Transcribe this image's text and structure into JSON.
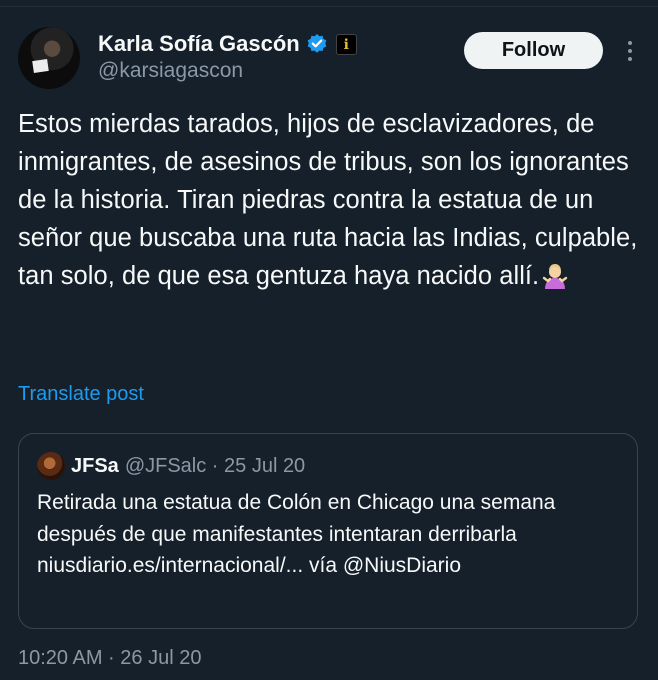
{
  "post": {
    "author": {
      "display_name": "Karla Sofía Gascón",
      "handle": "@karsiagascon",
      "verified_icon": "verified-badge-icon",
      "affiliation_icon": "affiliate-badge-icon",
      "affiliation_glyph": "ℹ"
    },
    "follow_label": "Follow",
    "text": "Estos mierdas tarados, hijos de esclavizadores, de inmigrantes, de asesinos de tribus, son los ignorantes de la historia. Tiran piedras contra la estatua de un señor que buscaba una ruta hacia las Indias, culpable, tan solo, de que esa gentuza haya nacido allí.",
    "emoji": "person-shrugging-emoji",
    "translate_label": "Translate post",
    "timestamp": "10:20 AM · 26 Jul 20"
  },
  "quoted_post": {
    "display_name": "JFSa",
    "meta": "@JFSalc · 25 Jul 20",
    "text": "Retirada una estatua de Colón en Chicago una semana después de que manifestantes intentaran derribarla niusdiario.es/internacional/... vía @NiusDiario"
  },
  "colors": {
    "background": "#15202b",
    "text": "#f7f9f9",
    "secondary_text": "#8b98a5",
    "link": "#1d9bf0",
    "border": "#38444d",
    "follow_bg": "#eff3f4"
  }
}
